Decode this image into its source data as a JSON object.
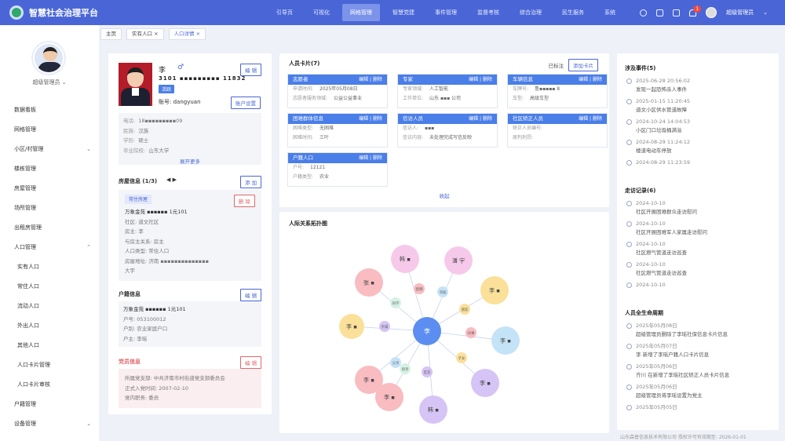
{
  "app": {
    "title": "智慧社会治理平台",
    "user": "超级管理员"
  },
  "nav": [
    "引导页",
    "可视化",
    "网格管理",
    "智慧党建",
    "事件管理",
    "监督考核",
    "综合治理",
    "民生服务",
    "系统"
  ],
  "notify_count": "1",
  "sidebar": {
    "user": "超级管理员",
    "items": [
      {
        "label": "数据看板",
        "arrow": ""
      },
      {
        "label": "网格管理",
        "arrow": ""
      },
      {
        "label": "小区/村管理",
        "arrow": "⌄"
      },
      {
        "label": "楼栋管理",
        "arrow": ""
      },
      {
        "label": "房屋管理",
        "arrow": ""
      },
      {
        "label": "场所管理",
        "arrow": ""
      },
      {
        "label": "出租房管理",
        "arrow": ""
      },
      {
        "label": "人口管理",
        "arrow": "⌃"
      },
      {
        "label": "实有人口",
        "arrow": "",
        "sub": true
      },
      {
        "label": "常住人口",
        "arrow": "",
        "sub": true
      },
      {
        "label": "流动人口",
        "arrow": "",
        "sub": true
      },
      {
        "label": "外出人口",
        "arrow": "",
        "sub": true
      },
      {
        "label": "其他人口",
        "arrow": "",
        "sub": true
      },
      {
        "label": "人口卡片管理",
        "arrow": "",
        "sub": true
      },
      {
        "label": "人口卡片审核",
        "arrow": "",
        "sub": true
      },
      {
        "label": "户籍管理",
        "arrow": ""
      },
      {
        "label": "设备管理",
        "arrow": "⌄"
      }
    ]
  },
  "tabs": [
    {
      "label": "主页",
      "close": ""
    },
    {
      "label": "实有人口 ×",
      "close": ""
    },
    {
      "label": "人口详情 ×",
      "close": ""
    }
  ],
  "profile": {
    "name": "李",
    "gender_symbol": "♂",
    "id_number": "3101 ▪▪▪▪▪▪▪▪▪ 11832",
    "tag": "活跃",
    "account_label": "账号:",
    "account": "dangyuan",
    "edit": "编 辑",
    "account_btn": "账户设置",
    "rows": [
      {
        "k": "电话:",
        "v": "18▪▪▪▪▪▪▪▪▪09"
      },
      {
        "k": "民族:",
        "v": "汉族"
      },
      {
        "k": "学历:",
        "v": "硕士"
      },
      {
        "k": "毕业院校:",
        "v": "山东大学"
      }
    ],
    "more": "展开更多",
    "house_title": "房屋信息 (1/3)",
    "house_add": "添 加",
    "house_del": "删 除",
    "house_type": "常住房屋",
    "house_rows": [
      {
        "k": "",
        "v": "万象金苑 ▪▪▪▪▪▪ 1元101"
      },
      {
        "k": "社区:",
        "v": "道文社区"
      },
      {
        "k": "房主:",
        "v": "李"
      },
      {
        "k": "与房主关系:",
        "v": "房主"
      },
      {
        "k": "人口类型:",
        "v": "常住人口"
      },
      {
        "k": "房屋地址:",
        "v": "济南 ▪▪▪▪▪▪▪▪▪▪▪▪▪▪"
      },
      {
        "k": "",
        "v": "大宇"
      }
    ],
    "huji_title": "户籍信息",
    "huji_edit": "编 辑",
    "huji_rows": [
      {
        "k": "",
        "v": "万象金苑 ▪▪▪▪▪▪ 1元101"
      },
      {
        "k": "户号:",
        "v": "053100012"
      },
      {
        "k": "户别:",
        "v": "农业家庭户口"
      },
      {
        "k": "户主:",
        "v": "李瑶"
      }
    ],
    "party_title": "党员信息",
    "party_edit": "编 辑",
    "party_rows": [
      {
        "k": "所属党支部:",
        "v": "中共济南市村街道党支部委员会"
      },
      {
        "k": "正式入党时间:",
        "v": "2007-02-10"
      },
      {
        "k": "党内职务:",
        "v": "委员"
      }
    ]
  },
  "cards": {
    "title": "人员卡片(7)",
    "flag": "已标注",
    "add": "添加卡片",
    "edit": "编辑",
    "del": "删除",
    "items": [
      {
        "title": "志愿者",
        "r1k": "申请时间:",
        "r1v": "2025年05月08日",
        "r2k": "志愿者服务领域:",
        "r2v": "公益公益事业"
      },
      {
        "title": "专家",
        "r1k": "专家领域:",
        "r1v": "人工智能",
        "r2k": "工作单位:",
        "r2v": "山东 ▪▪▪ 公司"
      },
      {
        "title": "车辆信息",
        "r1k": "车牌号:",
        "r1v": "鲁▪▪▪▪▪ 8",
        "r2k": "车型:",
        "r2v": "高级车型"
      },
      {
        "title": "困难群体信息",
        "r1k": "困难类型:",
        "r1v": "无困难",
        "r2k": "困难时间:",
        "r2v": "三叶"
      },
      {
        "title": "信访人员",
        "r1k": "信访人:",
        "r1v": "▪▪▪",
        "r2k": "信访内容:",
        "r2v": "未处理完成写信反映"
      },
      {
        "title": "社区矫正人员",
        "r1k": "矫正人员编号:",
        "r1v": "",
        "r2k": "原判刑罚:",
        "r2v": ""
      },
      {
        "title": "户籍人口",
        "r1k": "户号:",
        "r1v": "12121",
        "r2k": "户籍类型:",
        "r2v": "农业"
      }
    ],
    "collapse": "收起"
  },
  "graph": {
    "title": "人际关系拓扑图",
    "center": "李",
    "nodes": [
      {
        "label": "韩 ▪",
        "color": "#f6c9ea"
      },
      {
        "label": "潘 宇",
        "color": "#f6c9ea"
      },
      {
        "label": "张 ▪",
        "color": "#f8bcc1"
      },
      {
        "label": "李 ▪",
        "color": "#fbe09a"
      },
      {
        "label": "李 ▪",
        "color": "#fbe09a"
      },
      {
        "label": "李 ▪",
        "color": "#c5e3f7"
      },
      {
        "label": "李 ▪",
        "color": "#f8bcc1"
      },
      {
        "label": "李 ▪",
        "color": "#f8bcc1"
      },
      {
        "label": "李 ▪",
        "color": "#d5c4f5"
      },
      {
        "label": "韩 ▪",
        "color": "#d5c4f5"
      }
    ],
    "relations": [
      "配偶",
      "邻居",
      "同学",
      "朋友",
      "亲属",
      "同事",
      "父亲",
      "母亲",
      "子女",
      "室友"
    ]
  },
  "events": {
    "title": "涉及事件(5)",
    "items": [
      {
        "t": "2025-06-28 20:56:02",
        "c": "发现一起恐怖杀人事件"
      },
      {
        "t": "2025-01-15 11:20:45",
        "c": "道文小区供水管道故障"
      },
      {
        "t": "2024-10-24 14:04:53",
        "c": "小区门口垃圾桶满溢"
      },
      {
        "t": "2024-08-29 11:24:12",
        "c": "楼道电动车停放"
      },
      {
        "t": "2024-08-29 11:23:59",
        "c": ""
      }
    ]
  },
  "visits": {
    "title": "走访记录(6)",
    "items": [
      {
        "t": "2024-10-10",
        "c": "社区开展困难群众走访慰问"
      },
      {
        "t": "2024-10-10",
        "c": "社区开展困难军人家属走访慰问"
      },
      {
        "t": "2024-10-10",
        "c": "社区燃气管道走访巡查"
      },
      {
        "t": "2024-10-10",
        "c": "社区燃气管道走访巡查"
      },
      {
        "t": "2024-10-10",
        "c": ""
      }
    ]
  },
  "lifecycle": {
    "title": "人员全生命周期",
    "items": [
      {
        "t": "2025年05月08日",
        "c": "超级管理员删除了李瑶社保信息卡片信息"
      },
      {
        "t": "2025年05月07日",
        "c": "李 新增了李瑶户籍人口卡片信息"
      },
      {
        "t": "2025年05月06日",
        "c": "齐川 在新增了李瑶社区矫正人员卡片信息"
      },
      {
        "t": "2025年05月06日",
        "c": "超级管理员将李瑶设置为党主"
      },
      {
        "t": "2025年05月05日",
        "c": ""
      }
    ]
  },
  "footer": "山东森普信息技术有限公司   授权许可有效期至: 2026-01-01"
}
